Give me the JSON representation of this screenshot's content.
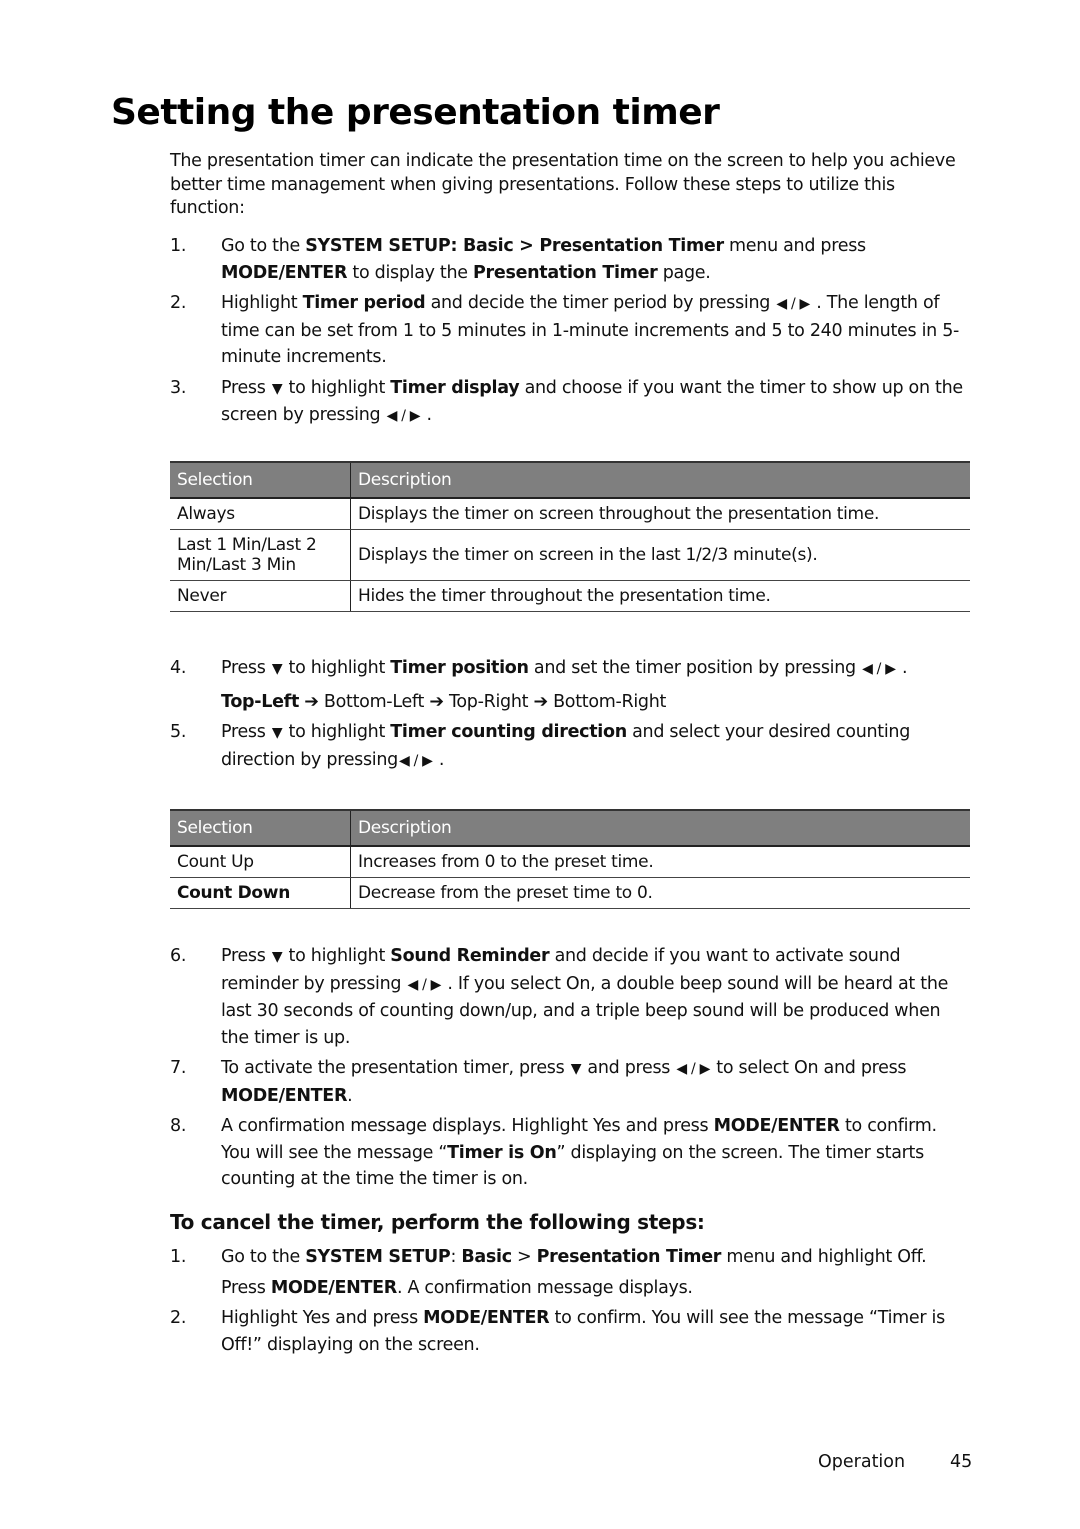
{
  "page": {
    "title": "Setting the presentation timer",
    "intro": "The presentation timer can indicate the presentation time on the screen to help you achieve better time management when giving presentations. Follow these steps to utilize this function:",
    "icons": {
      "left_right": "◀ / ▶",
      "down": "▼",
      "arrow": "➔"
    },
    "steps_a": [
      {
        "num": "1.",
        "parts": [
          "Go to the ",
          {
            "b": "SYSTEM SETUP: Basic > Presentation Timer"
          },
          " menu and press ",
          {
            "b": "MODE/ENTER"
          },
          " to display the ",
          {
            "b": "Presentation Timer"
          },
          " page."
        ]
      },
      {
        "num": "2.",
        "parts": [
          "Highlight ",
          {
            "b": "Timer period"
          },
          " and decide the timer period by pressing ",
          {
            "icon": "left_right"
          },
          " . The length of time can be set from 1 to 5 minutes in 1-minute increments and 5 to 240 minutes in 5-minute increments."
        ]
      },
      {
        "num": "3.",
        "parts": [
          "Press ",
          {
            "icon": "down"
          },
          "  to highlight ",
          {
            "b": "Timer display"
          },
          " and choose if you want the timer to show up on the screen by pressing ",
          {
            "icon": "left_right"
          },
          " ."
        ]
      }
    ],
    "table1": {
      "headers": [
        "Selection",
        "Description"
      ],
      "rows": [
        {
          "selection": "Always",
          "description": "Displays the timer on screen throughout the presentation time."
        },
        {
          "selection": "Last 1 Min/Last 2 Min/Last 3 Min",
          "description": "Displays the timer on screen in the last 1/2/3 minute(s)."
        },
        {
          "selection": "Never",
          "description": "Hides the timer throughout the presentation time."
        }
      ]
    },
    "steps_b": [
      {
        "num": "4.",
        "parts": [
          "Press ",
          {
            "icon": "down"
          },
          " to highlight ",
          {
            "b": "Timer position"
          },
          " and set the timer position by pressing ",
          {
            "icon": "left_right"
          },
          " ."
        ]
      },
      {
        "num": "5.",
        "parts": [
          "Press ",
          {
            "icon": "down"
          },
          " to highlight ",
          {
            "b": "Timer counting direction"
          },
          " and select your desired counting direction by pressing",
          {
            "icon": "left_right"
          },
          " ."
        ]
      }
    ],
    "position_sequence": [
      "Top-Left",
      "Bottom-Left",
      "Top-Right",
      "Bottom-Right"
    ],
    "table2": {
      "headers": [
        "Selection",
        "Description"
      ],
      "rows": [
        {
          "selection": "Count Up",
          "description": "Increases from 0 to the preset time.",
          "bold": false
        },
        {
          "selection": "Count Down",
          "description": "Decrease from the preset time to 0.",
          "bold": true
        }
      ]
    },
    "steps_c": [
      {
        "num": "6.",
        "parts": [
          "Press ",
          {
            "icon": "down"
          },
          "  to highlight ",
          {
            "b": "Sound Reminder"
          },
          " and decide if you want to activate sound reminder by pressing ",
          {
            "icon": "left_right"
          },
          " . If you select On, a double beep sound will be heard at the last 30 seconds of counting down/up, and a triple beep sound will be produced when the timer is up."
        ]
      },
      {
        "num": "7.",
        "parts": [
          "To activate the presentation timer, press ",
          {
            "icon": "down"
          },
          "  and press ",
          {
            "icon": "left_right"
          },
          "  to select On and press ",
          {
            "b": "MODE/ENTER"
          },
          "."
        ]
      },
      {
        "num": "8.",
        "parts": [
          "A confirmation message displays. Highlight Yes and press ",
          {
            "b": "MODE/ENTER"
          },
          " to confirm. You will see the message “",
          {
            "b": "Timer is On"
          },
          "” displaying on the  screen. The timer starts counting at the time the timer is on."
        ]
      }
    ],
    "cancel_heading": "To cancel the timer, perform the following steps:",
    "cancel_steps": [
      {
        "num": "1.",
        "parts": [
          "Go to the ",
          {
            "b": "SYSTEM SETUP"
          },
          ": ",
          {
            "b": "Basic"
          },
          " > ",
          {
            "b": "Presentation Timer"
          },
          " menu and highlight Off."
        ],
        "extra": [
          "Press ",
          {
            "b": "MODE/ENTER"
          },
          ". A confirmation message displays."
        ]
      },
      {
        "num": "2.",
        "parts": [
          "Highlight Yes and press ",
          {
            "b": "MODE/ENTER"
          },
          " to confirm. You will see the message “Timer is Off!” displaying on the screen."
        ]
      }
    ],
    "footer": {
      "section": "Operation",
      "page_number": "45"
    }
  }
}
